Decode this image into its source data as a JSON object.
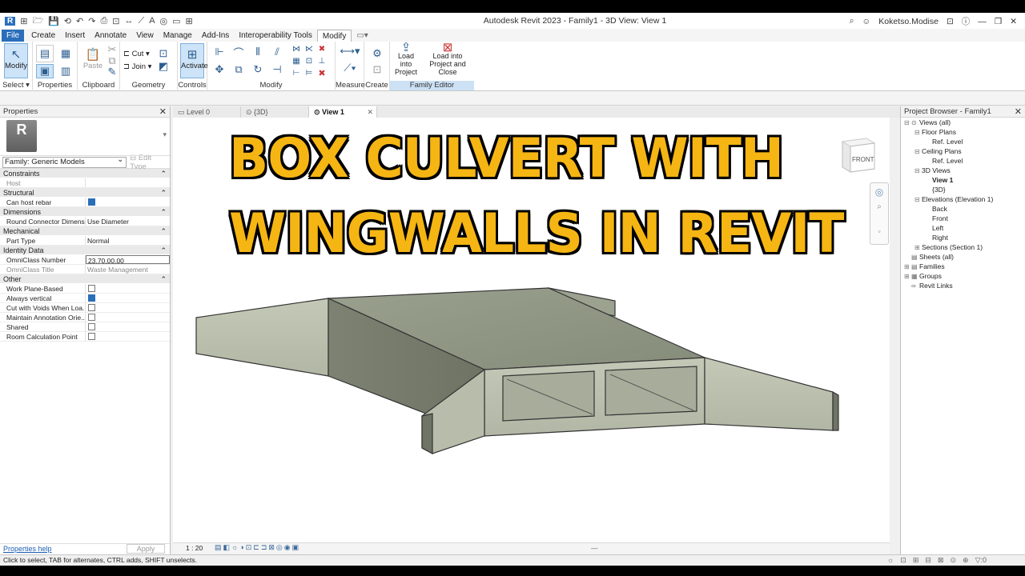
{
  "app": {
    "title": "Autodesk Revit 2023 - Family1 - 3D View: View 1",
    "user": "Koketso.Modise",
    "quick_access": [
      "R",
      "⊞",
      "🗁",
      "💾",
      "⟲",
      "↶",
      "↷",
      "⎙",
      "⊡",
      "↔",
      "⟋",
      "A",
      "◎",
      "▭",
      "⊞"
    ]
  },
  "ribbon_tabs": [
    "File",
    "Create",
    "Insert",
    "Annotate",
    "View",
    "Manage",
    "Add-Ins",
    "Interoperability Tools",
    "Modify"
  ],
  "ribbon_groups": {
    "select": "Select",
    "properties": "Properties",
    "clipboard": "Clipboard",
    "geometry": "Geometry",
    "controls": "Controls",
    "modify": "Modify",
    "measure": "Measure",
    "create": "Create",
    "family_editor": "Family Editor"
  },
  "ribbon_buttons": {
    "modify": "Modify",
    "paste": "Paste",
    "cut": "Cut",
    "join": "Join",
    "activate": "Activate",
    "load_project": "Load into\nProject",
    "load_close": "Load into\nProject and Close"
  },
  "properties": {
    "header": "Properties",
    "logo": "R",
    "family": "Family: Generic Models",
    "edit_type": "Edit Type",
    "help": "Properties help",
    "apply": "Apply",
    "sections": [
      {
        "name": "Constraints",
        "rows": [
          {
            "k": "Host",
            "v": "",
            "dim": true
          }
        ]
      },
      {
        "name": "Structural",
        "rows": [
          {
            "k": "Can host rebar",
            "check": true
          }
        ]
      },
      {
        "name": "Dimensions",
        "rows": [
          {
            "k": "Round Connector Dimens...",
            "v": "Use Diameter"
          }
        ]
      },
      {
        "name": "Mechanical",
        "rows": [
          {
            "k": "Part Type",
            "v": "Normal"
          }
        ]
      },
      {
        "name": "Identity Data",
        "rows": [
          {
            "k": "OmniClass Number",
            "v": "23.70.00.00",
            "box": true
          },
          {
            "k": "OmniClass Title",
            "v": "Waste Management",
            "dim": true
          }
        ]
      },
      {
        "name": "Other",
        "rows": [
          {
            "k": "Work Plane-Based",
            "check": false
          },
          {
            "k": "Always vertical",
            "check": true
          },
          {
            "k": "Cut with Voids When Loa...",
            "check": false
          },
          {
            "k": "Maintain Annotation Orie...",
            "check": false
          },
          {
            "k": "Shared",
            "check": false
          },
          {
            "k": "Room Calculation Point",
            "check": false
          }
        ]
      }
    ]
  },
  "view_tabs": [
    {
      "label": "Level 0",
      "active": false
    },
    {
      "label": "{3D}",
      "active": false
    },
    {
      "label": "View 1",
      "active": true
    }
  ],
  "headline": {
    "line1": "BOX CULVERT WITH",
    "line2": "WINGWALLS IN REVIT"
  },
  "viewcube_face": "FRONT",
  "view_scale": "1 : 20",
  "browser": {
    "header": "Project Browser - Family1",
    "tree": [
      {
        "label": "Views (all)",
        "lvl": 0,
        "tg": "⊟",
        "ic": "⊙"
      },
      {
        "label": "Floor Plans",
        "lvl": 1,
        "tg": "⊟"
      },
      {
        "label": "Ref. Level",
        "lvl": 2
      },
      {
        "label": "Ceiling Plans",
        "lvl": 1,
        "tg": "⊟"
      },
      {
        "label": "Ref. Level",
        "lvl": 2
      },
      {
        "label": "3D Views",
        "lvl": 1,
        "tg": "⊟"
      },
      {
        "label": "View 1",
        "lvl": 2,
        "bold": true
      },
      {
        "label": "{3D}",
        "lvl": 2
      },
      {
        "label": "Elevations (Elevation 1)",
        "lvl": 1,
        "tg": "⊟"
      },
      {
        "label": "Back",
        "lvl": 2
      },
      {
        "label": "Front",
        "lvl": 2
      },
      {
        "label": "Left",
        "lvl": 2
      },
      {
        "label": "Right",
        "lvl": 2
      },
      {
        "label": "Sections (Section 1)",
        "lvl": 1,
        "tg": "⊞"
      },
      {
        "label": "Sheets (all)",
        "lvl": 0,
        "tg": "",
        "ic": "▤"
      },
      {
        "label": "Families",
        "lvl": 0,
        "tg": "⊞",
        "ic": "▤"
      },
      {
        "label": "Groups",
        "lvl": 0,
        "tg": "⊞",
        "ic": "▦"
      },
      {
        "label": "Revit Links",
        "lvl": 0,
        "tg": "",
        "ic": "∞"
      }
    ]
  },
  "status": {
    "message": "Click to select, TAB for alternates, CTRL adds, SHIFT unselects.",
    "filter_count": ":0"
  }
}
